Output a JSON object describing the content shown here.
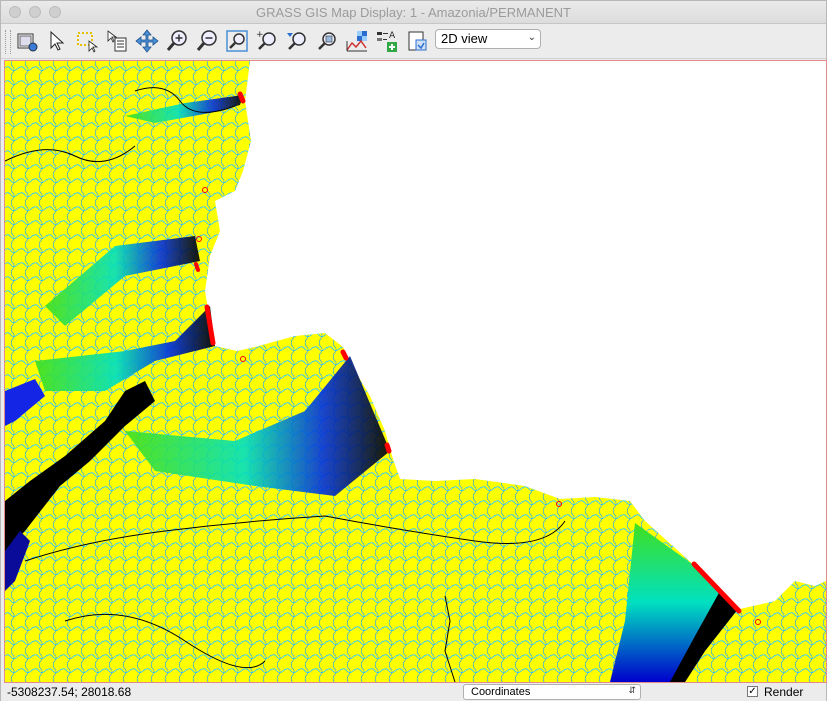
{
  "window": {
    "title": "GRASS GIS Map Display: 1 - Amazonia/PERMANENT"
  },
  "toolbar": {
    "tools": [
      {
        "name": "display-map-icon"
      },
      {
        "name": "pointer-icon"
      },
      {
        "name": "select-icon"
      },
      {
        "name": "query-icon"
      },
      {
        "name": "pan-icon"
      },
      {
        "name": "zoom-in-icon"
      },
      {
        "name": "zoom-out-icon"
      },
      {
        "name": "zoom-extent-icon"
      },
      {
        "name": "zoom-back-icon"
      },
      {
        "name": "zoom-menu-icon"
      },
      {
        "name": "zoom-selected-icon"
      },
      {
        "name": "analyze-icon"
      },
      {
        "name": "overlay-icon"
      },
      {
        "name": "save-image-icon"
      }
    ],
    "view_mode": "2D view"
  },
  "statusbar": {
    "coordinates": "-5308237.54; 28018.68",
    "mode": "Coordinates",
    "render_label": "Render",
    "render_checked": true
  },
  "map": {
    "colors": {
      "land": "#ffff00",
      "streams": "#00bfff",
      "deep": "#0000cc",
      "void": "#000000",
      "mid": "#00e0a0",
      "low": "#40e020",
      "outlet": "#ff0000",
      "background": "#ffffff"
    }
  }
}
